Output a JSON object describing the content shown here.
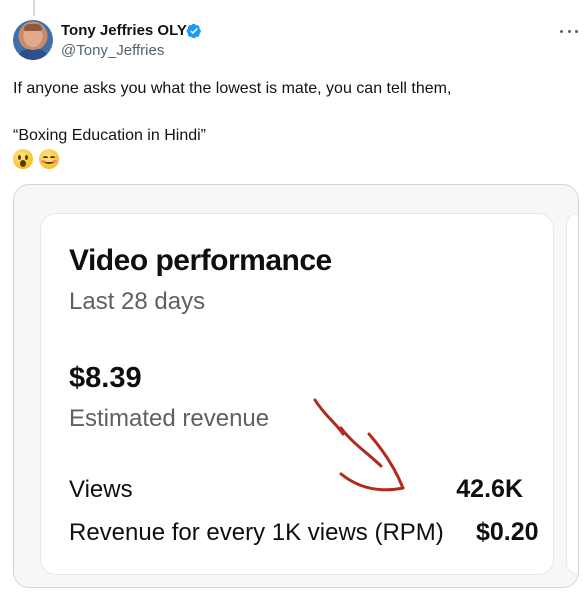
{
  "tweet": {
    "author": {
      "display_name": "Tony Jeffries OLY",
      "handle": "@Tony_Jeffries",
      "verified": true
    },
    "text_line1": "If anyone asks you what the lowest is mate, you can tell them,",
    "text_line2": "“Boxing Education in Hindi”",
    "emojis": [
      "hushed-face",
      "smiling-face-with-blush"
    ]
  },
  "media": {
    "card": {
      "title": "Video performance",
      "subtitle": "Last 28 days",
      "revenue_value": "$8.39",
      "revenue_label": "Estimated revenue",
      "views_label": "Views",
      "views_value": "42.6K",
      "rpm_label": "Revenue for every 1K views (RPM)",
      "rpm_value": "$0.20"
    },
    "annotation": {
      "type": "hand-drawn-arrow",
      "color": "#b02a1e"
    }
  },
  "colors": {
    "verified_badge": "#1d9bf0",
    "secondary_text": "#536471"
  }
}
